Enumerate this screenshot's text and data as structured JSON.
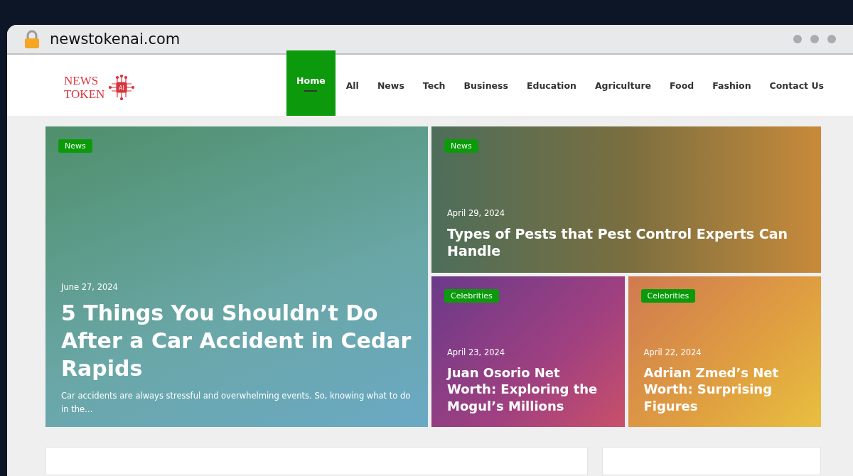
{
  "browser": {
    "url": "newstokenai.com"
  },
  "logo": {
    "line_1": "NEWS",
    "line_2": "TOKEN",
    "chip": "AI"
  },
  "nav": [
    {
      "label": "Home",
      "selected": true
    },
    {
      "label": "All",
      "selected": false
    },
    {
      "label": "News",
      "selected": false
    },
    {
      "label": "Tech",
      "selected": false
    },
    {
      "label": "Business",
      "selected": false
    },
    {
      "label": "Education",
      "selected": false
    },
    {
      "label": "Agriculture",
      "selected": false
    },
    {
      "label": "Food",
      "selected": false
    },
    {
      "label": "Fashion",
      "selected": false
    },
    {
      "label": "Contact Us",
      "selected": false
    }
  ],
  "posts": [
    {
      "kind": "large",
      "category": "News",
      "date": "June 27, 2024",
      "title": "5 Things You Shouldn’t Do After a Car Accident in Cedar Rapids",
      "excerpt": "Car accidents are always stressful and overwhelming events. So, knowing what to do in the…"
    },
    {
      "kind": "wide",
      "category": "News",
      "date": "April 29, 2024",
      "title": "Types of Pests that Pest Control Experts Can Handle"
    },
    {
      "kind": "small",
      "category": "Celebrities",
      "date": "April 23, 2024",
      "title": "Juan Osorio Net Worth: Exploring the Mogul’s Millions"
    },
    {
      "kind": "small",
      "category": "Celebrities",
      "date": "April 22, 2024",
      "title": "Adrian Zmed’s Net Worth: Surprising Figures"
    }
  ]
}
